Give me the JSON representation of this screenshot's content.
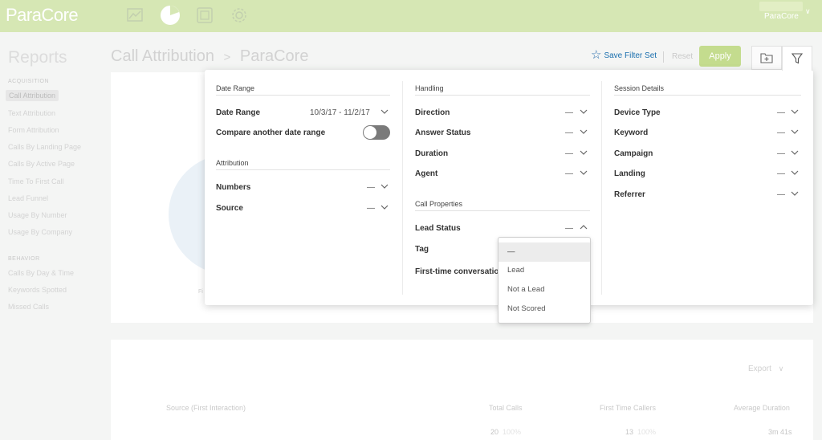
{
  "app": {
    "logo": "ParaCore",
    "account_name": "ParaCore"
  },
  "topnav": [
    "chart-icon",
    "pie-icon",
    "dashboard-icon",
    "gear-icon"
  ],
  "sidebar": {
    "title": "Reports",
    "sections": [
      {
        "label": "ACQUISITION",
        "items": [
          "Call Attribution",
          "Text Attribution",
          "Form Attribution",
          "Calls By Landing Page",
          "Calls By Active Page",
          "Time To First Call",
          "Lead Funnel",
          "Usage By Number",
          "Usage By Company"
        ]
      },
      {
        "label": "BEHAVIOR",
        "items": [
          "Calls By Day & Time",
          "Keywords Spotted",
          "Missed Calls"
        ]
      }
    ],
    "active_item": "Call Attribution"
  },
  "breadcrumb": {
    "page": "Call Attribution",
    "separator": ">",
    "account": "ParaCore"
  },
  "toolbar": {
    "save_filter_set": "Save Filter Set",
    "reset": "Reset",
    "apply": "Apply"
  },
  "filter_panel": {
    "date_range_header": "Date Range",
    "date_range_label": "Date Range",
    "date_range_value": "10/3/17 - 11/2/17",
    "compare_label": "Compare another date range",
    "compare_enabled": false,
    "attribution_header": "Attribution",
    "attribution": [
      {
        "label": "Numbers",
        "value": "—"
      },
      {
        "label": "Source",
        "value": "—"
      }
    ],
    "handling_header": "Handling",
    "handling": [
      {
        "label": "Direction",
        "value": "—"
      },
      {
        "label": "Answer Status",
        "value": "—"
      },
      {
        "label": "Duration",
        "value": "—"
      },
      {
        "label": "Agent",
        "value": "—"
      }
    ],
    "call_properties_header": "Call Properties",
    "call_properties": [
      {
        "label": "Lead Status",
        "value": "—"
      },
      {
        "label": "Tag",
        "value": ""
      },
      {
        "label": "First-time conversatio",
        "value": ""
      }
    ],
    "session_header": "Session Details",
    "session": [
      {
        "label": "Device Type",
        "value": "—"
      },
      {
        "label": "Keyword",
        "value": "—"
      },
      {
        "label": "Campaign",
        "value": "—"
      },
      {
        "label": "Landing",
        "value": "—"
      },
      {
        "label": "Referrer",
        "value": "—"
      }
    ]
  },
  "lead_status_dropdown": {
    "options": [
      "—",
      "Lead",
      "Not a Lead",
      "Not Scored"
    ],
    "selected": "—"
  },
  "background": {
    "export_label": "Export",
    "chart_fragment": "Fi",
    "table_headers": [
      "Source (First Interaction)",
      "Total Calls",
      "First Time Callers",
      "Average Duration"
    ],
    "first_row": {
      "total_calls": "20",
      "total_calls_pct": "100%",
      "first_time": "13",
      "first_time_pct": "100%",
      "avg_duration": "3m 41s"
    }
  },
  "colors": {
    "topbar": "#d6e7b4",
    "apply": "#c4dc8e",
    "link": "#1a6fae",
    "toggle_off": "#7a7a7a"
  }
}
